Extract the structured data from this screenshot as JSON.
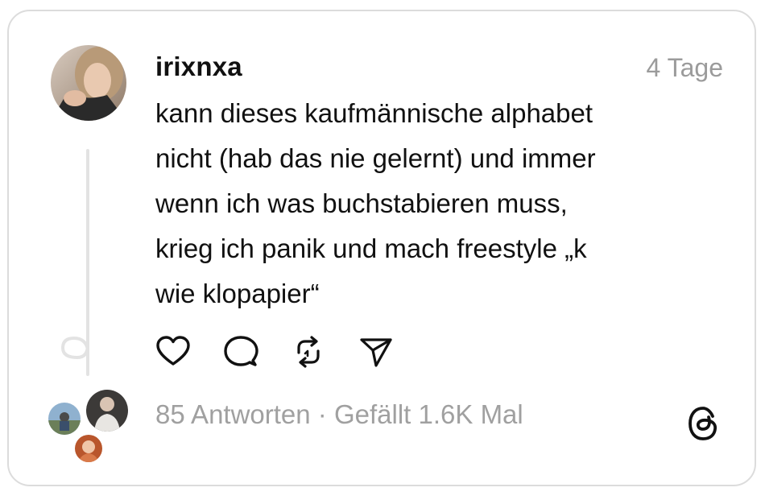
{
  "post": {
    "username": "irixnxa",
    "time": "4 Tage",
    "text": "kann dieses kaufmännische alphabet\nnicht (hab das nie gelernt) und immer\nwenn ich was buchstabieren muss,\nkrieg ich panik und mach freestyle „k\nwie klopapier“"
  },
  "footer": {
    "replies": "85 Antworten",
    "separator": " · ",
    "likes": "Gefällt 1.6K Mal"
  },
  "icons": {
    "like": "heart-icon",
    "reply": "comment-icon",
    "repost": "repost-icon",
    "share": "send-icon",
    "brand": "threads-logo-icon"
  },
  "colors": {
    "text": "#111111",
    "muted": "#9b9b9b",
    "border": "#dcdcdc"
  }
}
